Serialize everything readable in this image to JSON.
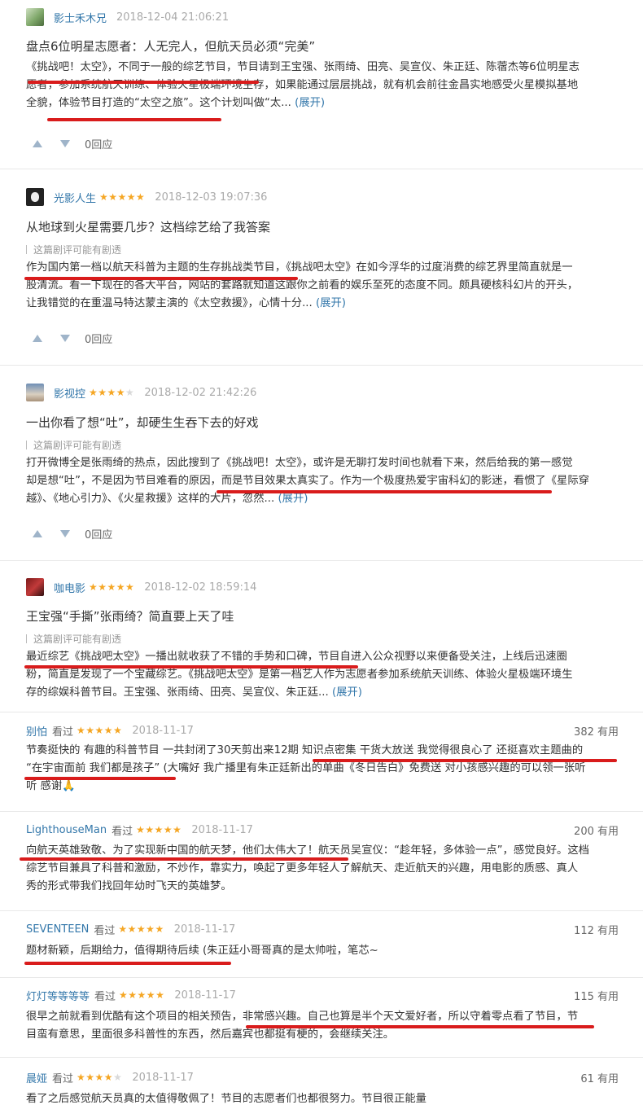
{
  "reviews": [
    {
      "user": "影士禾木兄",
      "stars": 0,
      "time": "2018-12-04 21:06:21",
      "title": "盘点6位明星志愿者：人无完人，但航天员必须“完美”",
      "lines": [
        "《挑战吧！太空》，不同于一般的综艺节目，节目请到王宝强、张雨绮、田亮、吴宣仪、朱正廷、陈蓿杰等6位明星志",
        "愿者，参加系统航天训练、体验火星极端环境生存，如果能通过层层挑战，就有机会前往金昌实地感受火星模拟基地",
        "全貌，体验节目打造的“太空之旅”。这个计划叫做“太..."
      ],
      "expand": "(展开)",
      "replies": "0回应"
    },
    {
      "user": "光影人生",
      "stars": 5,
      "time": "2018-12-03 19:07:36",
      "title": "从地球到火星需要几步？这档综艺给了我答案",
      "spoiler": "这篇剧评可能有剧透",
      "lines": [
        "作为国内第一档以航天科普为主题的生存挑战类节目，《挑战吧太空》在如今浮华的过度消费的综艺界里简直就是一",
        "股清流。看一下现在的各大平台，网站的套路就知道这跟你之前看的娱乐至死的态度不同。颇具硬核科幻片的开头，",
        "让我错觉的在重温马特达蒙主演的《太空救援》，心情十分..."
      ],
      "expand": "(展开)",
      "replies": "0回应"
    },
    {
      "user": "影视控",
      "stars": 4,
      "time": "2018-12-02 21:42:26",
      "title": "一出你看了想“吐”，却硬生生吞下去的好戏",
      "spoiler": "这篇剧评可能有剧透",
      "lines": [
        "打开微博全是张雨绮的热点，因此搜到了《挑战吧！太空》，或许是无聊打发时间也就看下来，然后给我的第一感觉",
        "却是想“吐”，不是因为节目难看的原因，而是节目效果太真实了。作为一个极度热爱宇宙科幻的影迷，看惯了《星际穿",
        "越》、《地心引力》、《火星救援》这样的大片，忽然..."
      ],
      "expand": "(展开)",
      "replies": "0回应"
    },
    {
      "user": "咖电影",
      "stars": 5,
      "time": "2018-12-02 18:59:14",
      "title": "王宝强“手撕”张雨绮？简直要上天了哇",
      "spoiler": "这篇剧评可能有剧透",
      "lines": [
        "最近综艺《挑战吧太空》一播出就收获了不错的手势和口碑，节目自进入公众视野以来便备受关注，上线后迅速圈",
        "粉，简直是发现了一个宝藏综艺。《挑战吧太空》是第一档艺人作为志愿者参加系统航天训练、体验火星极端环境生",
        "存的综娱科普节目。王宝强、张雨绮、田亮、吴宣仪、朱正廷..."
      ],
      "expand": "(展开)"
    }
  ],
  "comments": [
    {
      "user": "别怕",
      "seen": "看过",
      "stars": 5,
      "time": "2018-11-17",
      "useful": "382 有用",
      "lines": [
        "节奏挺快的 有趣的科普节目 一共封闭了30天剪出来12期 知识点密集 干货大放送 我觉得很良心了 还挺喜欢主题曲的",
        "“在宇宙面前 我们都是孩子” (大嘴好 我广播里有朱正廷新出的单曲《冬日告白》免费送 对小孩感兴趣的可以领一张听",
        "听 感谢🙏"
      ]
    },
    {
      "user": "LighthouseMan",
      "seen": "看过",
      "stars": 5,
      "time": "2018-11-17",
      "useful": "200 有用",
      "lines": [
        "向航天英雄致敬、为了实现新中国的航天梦，他们太伟大了！航天员吴宣仪：“趁年轻，多体验一点”，感觉良好。这档",
        "综艺节目兼具了科普和激励，不炒作，靠实力，唤起了更多年轻人了解航天、走近航天的兴趣，用电影的质感、真人",
        "秀的形式带我们找回年幼时飞天的英雄梦。"
      ]
    },
    {
      "user": "SEVENTEEN",
      "seen": "看过",
      "stars": 5,
      "time": "2018-11-17",
      "useful": "112 有用",
      "lines": [
        "题材新颖，后期给力，值得期待后续 (朱正廷小哥哥真的是太帅啦，笔芯~"
      ]
    },
    {
      "user": "灯灯等等等等",
      "seen": "看过",
      "stars": 5,
      "time": "2018-11-17",
      "useful": "115 有用",
      "lines": [
        "很早之前就看到优酷有这个项目的相关预告，非常感兴趣。自己也算是半个天文爱好者，所以守着零点看了节目，节",
        "目蛮有意思，里面很多科普性的东西，然后嘉宾也都挺有梗的，会继续关注。"
      ]
    },
    {
      "user": "晨娅",
      "seen": "看过",
      "stars": 4,
      "time": "2018-11-17",
      "useful": "61 有用",
      "lines": [
        "看了之后感觉航天员真的太值得敬佩了！节目的志愿者们也都很努力。节目很正能量"
      ]
    }
  ]
}
